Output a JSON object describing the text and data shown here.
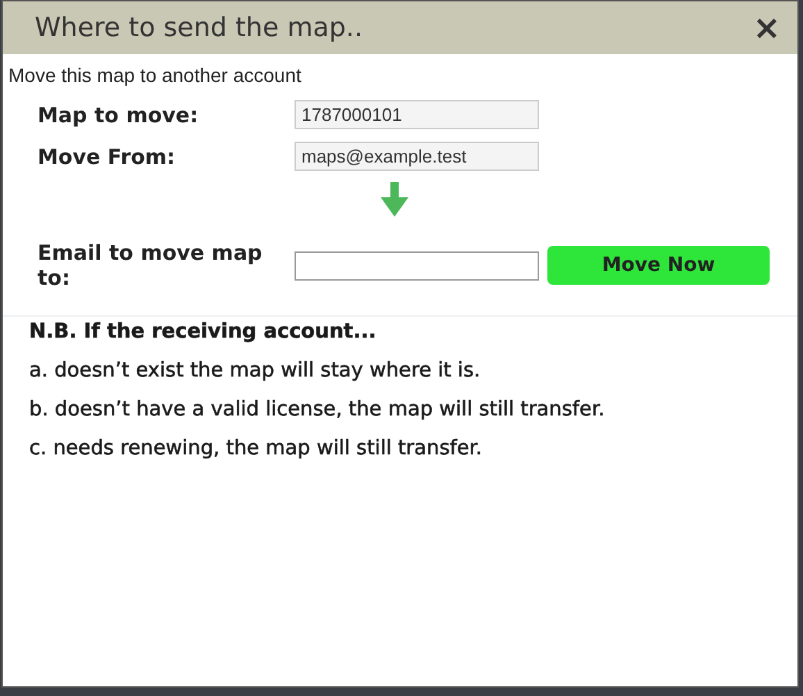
{
  "dialog": {
    "title": "Where to send the map..",
    "close": "×",
    "subtitle": "Move this map to another account",
    "fields": [
      {
        "label": "Map to move:",
        "value": "1787000101"
      },
      {
        "label": "Move From:",
        "value": "maps@example.test"
      }
    ],
    "email_field": {
      "label": "Email to move map to:"
    },
    "button": "Move Now",
    "note_heading": "N.B. If the receiving account...",
    "notes": [
      "a. doesn’t exist the map will stay where it is.",
      "b. doesn’t have a valid license, the map will still transfer.",
      "c. needs renewing, the map will still transfer."
    ]
  }
}
